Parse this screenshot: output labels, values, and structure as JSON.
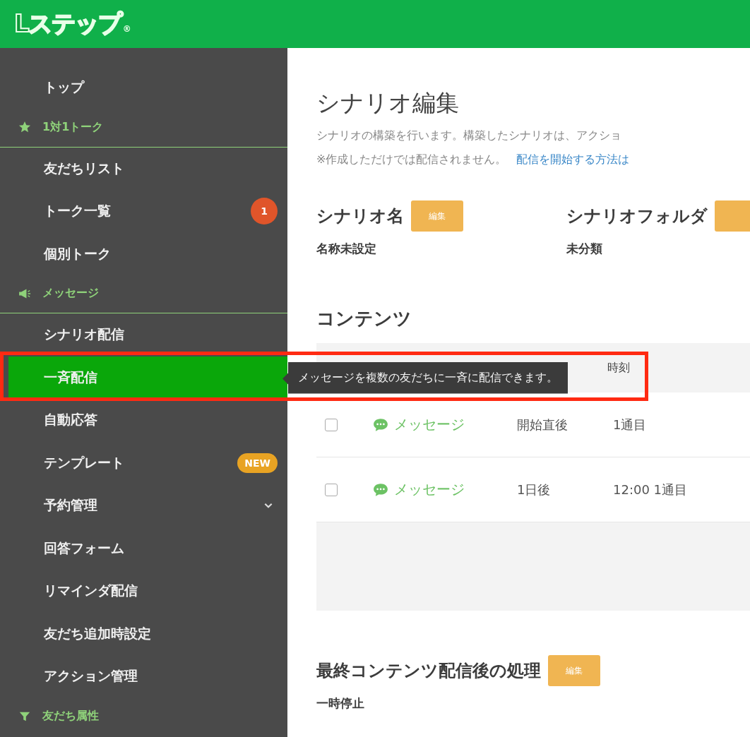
{
  "header": {
    "logo": "Lステップ",
    "logo_mark": "®"
  },
  "sidebar": {
    "items": [
      {
        "kind": "link",
        "label": "トップ",
        "selected": false
      },
      {
        "kind": "section",
        "label": "1対1トーク"
      },
      {
        "kind": "link",
        "label": "友だちリスト",
        "selected": false
      },
      {
        "kind": "link",
        "label": "トーク一覧",
        "selected": false,
        "badge": {
          "kind": "count",
          "text": "1"
        }
      },
      {
        "kind": "link",
        "label": "個別トーク",
        "selected": false
      },
      {
        "kind": "section",
        "label": "メッセージ"
      },
      {
        "kind": "link",
        "label": "シナリオ配信",
        "selected": false
      },
      {
        "kind": "link",
        "label": "一斉配信",
        "selected": true,
        "tooltip": "メッセージを複数の友だちに一斉に配信できます。"
      },
      {
        "kind": "link",
        "label": "自動応答",
        "selected": false
      },
      {
        "kind": "link",
        "label": "テンプレート",
        "selected": false,
        "badge": {
          "kind": "new",
          "text": "NEW"
        }
      },
      {
        "kind": "link",
        "label": "予約管理",
        "selected": false,
        "expanded": false
      },
      {
        "kind": "link",
        "label": "回答フォーム",
        "selected": false
      },
      {
        "kind": "link",
        "label": "リマインダ配信",
        "selected": false
      },
      {
        "kind": "link",
        "label": "友だち追加時設定",
        "selected": false
      },
      {
        "kind": "link",
        "label": "アクション管理",
        "selected": false
      },
      {
        "kind": "section",
        "label": "友だち属性"
      }
    ]
  },
  "page": {
    "title": "シナリオ編集",
    "description": "シナリオの構築を行います。構築したシナリオは、アクショ",
    "note": "※作成しただけでは配信されません。",
    "note_link": "配信を開始する方法は",
    "fields": [
      {
        "label": "シナリオ名",
        "button": "編集",
        "value": "名称未設定"
      },
      {
        "label": "シナリオフォルダ",
        "value": "未分類"
      }
    ],
    "contents": {
      "title": "コンテンツ",
      "column_4": "時刻",
      "rows": [
        {
          "checked": false,
          "type": "メッセージ",
          "timing": "開始直後",
          "time": "1通目"
        },
        {
          "checked": false,
          "type": "メッセージ",
          "timing": "1日後",
          "time": "12:00 1通目"
        }
      ]
    },
    "after": {
      "title": "最終コンテンツ配信後の処理",
      "button": "編集",
      "value": "一時停止"
    }
  }
}
